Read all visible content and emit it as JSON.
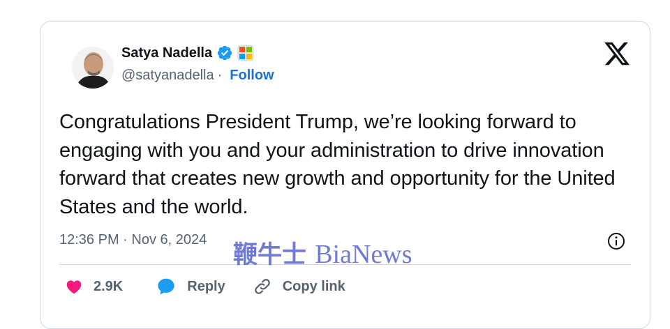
{
  "user": {
    "name": "Satya Nadella",
    "handle": "@satyanadella",
    "separator": "·",
    "follow_label": "Follow"
  },
  "tweet": {
    "text": "Congratulations President Trump, we’re looking forward to engaging with you and your administration to drive innovation forward that creates new growth and opportunity for the United States and the world.",
    "timestamp": "12:36 PM · Nov 6, 2024"
  },
  "actions": {
    "likes": "2.9K",
    "reply_label": "Reply",
    "copy_label": "Copy link"
  },
  "watermark": {
    "cn": "鞭牛士",
    "en": "BiaNews"
  },
  "colors": {
    "link": "#1d6fd6",
    "like": "#f91880",
    "reply_icon": "#1d9bf0",
    "verified": "#1d9bf0",
    "muted": "#536471",
    "border": "#cfd9de"
  },
  "icons": [
    "verified-badge-icon",
    "affiliate-badge-icon",
    "x-logo-icon",
    "info-icon",
    "heart-icon",
    "reply-bubble-icon",
    "link-icon"
  ]
}
